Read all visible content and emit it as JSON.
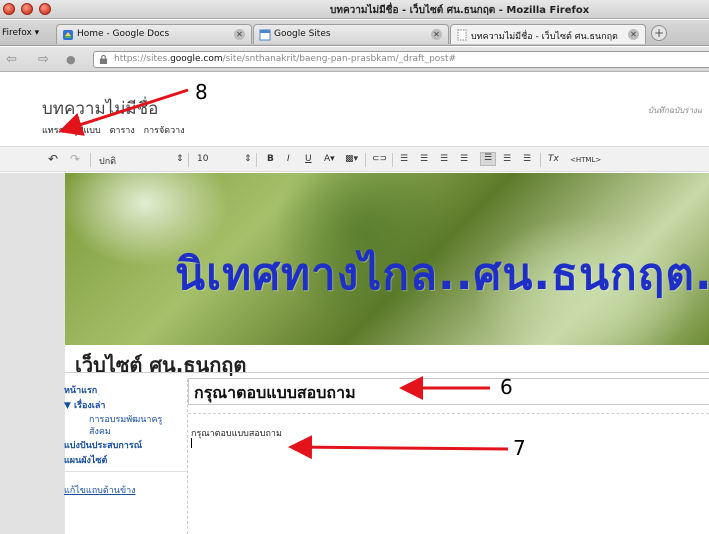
{
  "window": {
    "title": "บทความไม่มีชื่อ - เว็บไซต์ ศน.ธนกฤต - Mozilla Firefox"
  },
  "tabs": {
    "menu_label": "Firefox ▾",
    "items": [
      {
        "label": "Home - Google Docs"
      },
      {
        "label": "Google Sites"
      },
      {
        "label": "บทความไม่มีชื่อ - เว็บไซต์ ศน.ธนกฤต"
      }
    ],
    "new_tab": "+"
  },
  "nav": {
    "url_prefix": "https://sites.",
    "url_domain": "google.com",
    "url_path": "/site/snthanakrit/baeng-pan-prasbkam/_draft_post#"
  },
  "editor": {
    "doc_title": "บทความไม่มีชื่อ",
    "saved_note": "บันทึกฉบับร่างแ",
    "menu": [
      "แทรก",
      "รูปแบบ",
      "ตาราง",
      "การจัดวาง"
    ],
    "style_select": "ปกติ",
    "size_select": "10",
    "html_button": "<HTML>"
  },
  "site": {
    "banner_text": "นิเทศทางไกล..ศน.ธนกฤต..",
    "name": "เว็บไซต์ ศน.ธนกฤต",
    "nav": [
      {
        "label": "หน้าแรก"
      },
      {
        "label": "▼ เรื่องเล่า"
      },
      {
        "label": "การอบรมพัฒนาครู"
      },
      {
        "label": "สังคม"
      },
      {
        "label": "แบ่งปันประสบการณ์"
      },
      {
        "label": "แผนผังไซต์"
      }
    ],
    "edit_sidebar": "แก้ไขแถบด้านข้าง",
    "post_title": "กรุณาตอบแบบสอบถาม",
    "post_body": "กรุณาตอบแบบสอบถาม"
  },
  "annotations": [
    "8",
    "6",
    "7"
  ],
  "colors": {
    "banner_text": "#1e2fc8",
    "annotation": "#e3131b",
    "link": "#1a4fa0"
  }
}
